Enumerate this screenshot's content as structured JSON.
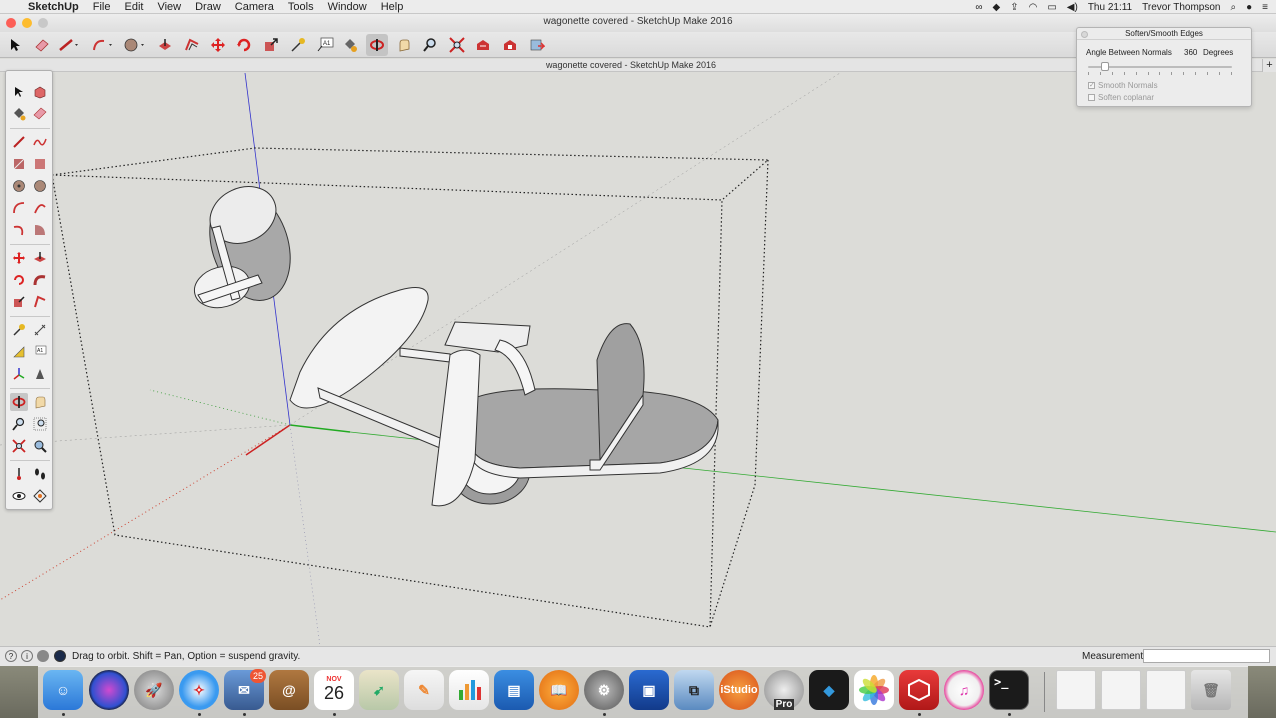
{
  "menubar": {
    "app_name": "SketchUp",
    "items": [
      "File",
      "Edit",
      "View",
      "Draw",
      "Camera",
      "Tools",
      "Window",
      "Help"
    ],
    "clock": "Thu 21:11",
    "user": "Trevor Thompson"
  },
  "window": {
    "title": "wagonette covered - SketchUp Make 2016",
    "doc_title": "wagonette covered - SketchUp Make 2016",
    "tab_add": "+"
  },
  "toolbar": {
    "tools": [
      "select-tool",
      "eraser-tool",
      "line-tool",
      "arc-tool",
      "shapes-tool",
      "push-pull-tool",
      "offset-tool",
      "move-tool",
      "rotate-tool",
      "scale-tool",
      "tape-measure-tool",
      "text-tool",
      "paint-bucket-tool",
      "orbit-tool",
      "pan-tool",
      "zoom-tool",
      "zoom-extents-tool",
      "3d-warehouse-tool",
      "extension-warehouse-tool",
      "layout-tool"
    ],
    "active": "orbit-tool"
  },
  "soften_panel": {
    "title": "Soften/Smooth Edges",
    "angle_label": "Angle Between Normals",
    "angle_value": "360",
    "angle_unit": "Degrees",
    "smooth_normals_label": "Smooth Normals",
    "smooth_normals_checked": true,
    "soften_coplanar_label": "Soften coplanar",
    "soften_coplanar_checked": false,
    "slider_position": 0.12
  },
  "status": {
    "hint": "Drag to orbit. Shift = Pan, Option = suspend gravity.",
    "measurements_label": "Measurements",
    "measurements_value": ""
  },
  "dock": {
    "calendar_month": "NOV",
    "calendar_day": "26",
    "mail_badge": "25",
    "istudio_label": "iStudio",
    "pro_label": "Pro",
    "terminal_prompt": ">_"
  },
  "colors": {
    "viewport_bg": "#dcdcd8",
    "axis_red": "#cc2222",
    "axis_green": "#22aa22",
    "axis_blue": "#2233cc"
  }
}
